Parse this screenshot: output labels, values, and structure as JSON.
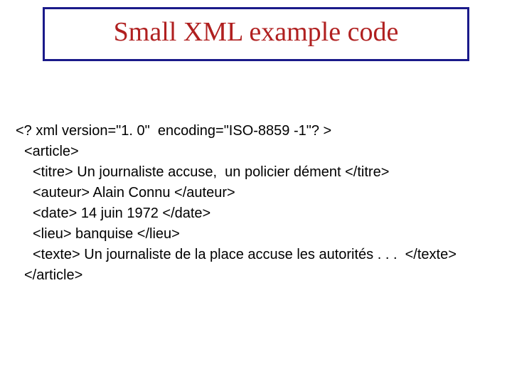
{
  "title": "Small XML example code",
  "code": {
    "l0": "<? xml version=\"1. 0\"  encoding=\"ISO-8859 -1\"? >",
    "l1": "<article>",
    "l2": "<titre> Un journaliste accuse,  un policier dément </titre>",
    "l3": "<auteur> Alain Connu </auteur>",
    "l4": "<date> 14 juin 1972 </date>",
    "l5": "<lieu> banquise </lieu>",
    "l6": "<texte> Un journaliste de la place accuse les autorités . . .  </texte>",
    "l7": "</article>"
  }
}
